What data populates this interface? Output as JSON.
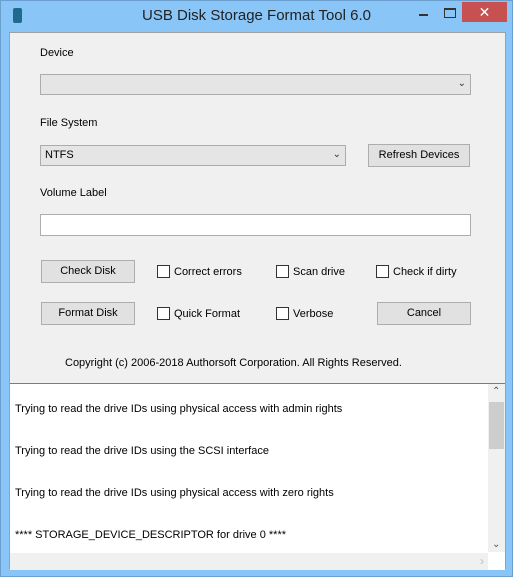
{
  "window": {
    "title": "USB Disk Storage Format Tool 6.0",
    "minimize": "─",
    "close": "✕"
  },
  "form": {
    "device_label": "Device",
    "device_value": "",
    "fs_label": "File System",
    "fs_value": "NTFS",
    "refresh_button": "Refresh Devices",
    "volume_label": "Volume Label",
    "volume_value": "",
    "check_disk": "Check Disk",
    "format_disk": "Format Disk",
    "cancel": "Cancel",
    "correct_errors": {
      "label": "Correct errors",
      "checked": false
    },
    "scan_drive": {
      "label": "Scan drive",
      "checked": false
    },
    "check_dirty": {
      "label": "Check if dirty",
      "checked": false
    },
    "quick_format": {
      "label": "Quick Format",
      "checked": false
    },
    "verbose": {
      "label": "Verbose",
      "checked": false
    },
    "copyright": "Copyright (c) 2006-2018 Authorsoft Corporation. All Rights Reserved."
  },
  "log": {
    "lines": [
      "Trying to read the drive IDs using physical access with admin rights",
      "Trying to read the drive IDs using the SCSI interface",
      "Trying to read the drive IDs using physical access with zero rights",
      "**** STORAGE_DEVICE_DESCRIPTOR for drive 0 ****"
    ]
  }
}
